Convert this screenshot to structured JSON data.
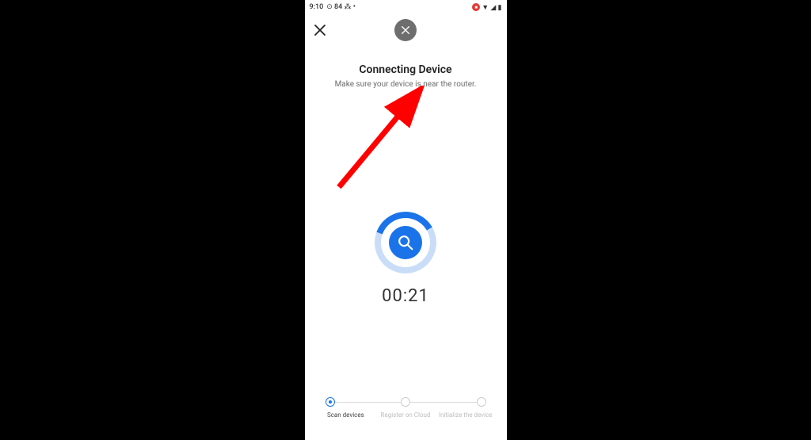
{
  "status_bar": {
    "time": "9:10",
    "icons_left": "⊙ 84 ⁂ •",
    "icons_right_rec": "●",
    "icons_right": "▼ ◢ ▮"
  },
  "header": {
    "close_left": "✕",
    "close_pill": "✕"
  },
  "title": "Connecting Device",
  "subtitle": "Make sure your device is near the router.",
  "timer": "00:21",
  "steps": {
    "s1": "Scan\ndevices",
    "s2": "Register on\nCloud",
    "s3": "Initialize the\ndevice"
  }
}
